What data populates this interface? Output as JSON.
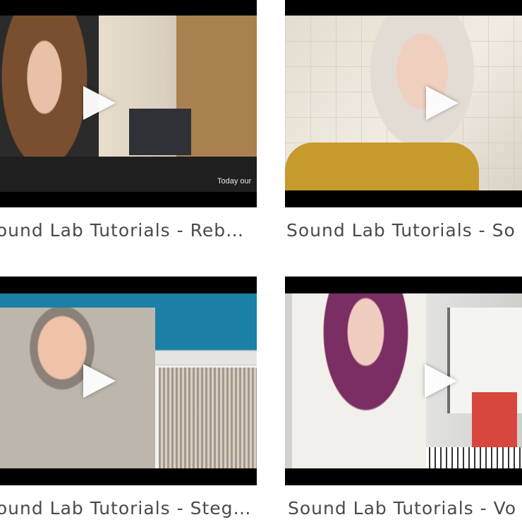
{
  "videos": [
    {
      "title": "Sound Lab Tutorials - Rebecca",
      "overlay_caption": "Today our",
      "colors": {
        "scene": "#c9b9a3",
        "accent": "#8b5e3c"
      }
    },
    {
      "title": "Sound Lab Tutorials - So",
      "colors": {
        "scene": "#d9d3c6",
        "accent": "#c79a2c"
      }
    },
    {
      "title": "Sound Lab Tutorials - Steg G s",
      "colors": {
        "scene": "#e7e5e0",
        "accent": "#1b7fa6"
      }
    },
    {
      "title": "Sound Lab Tutorials - Vo",
      "colors": {
        "scene": "#d8d8d6",
        "accent": "#7b2e63"
      }
    }
  ],
  "icons": {
    "play": "play-icon"
  }
}
